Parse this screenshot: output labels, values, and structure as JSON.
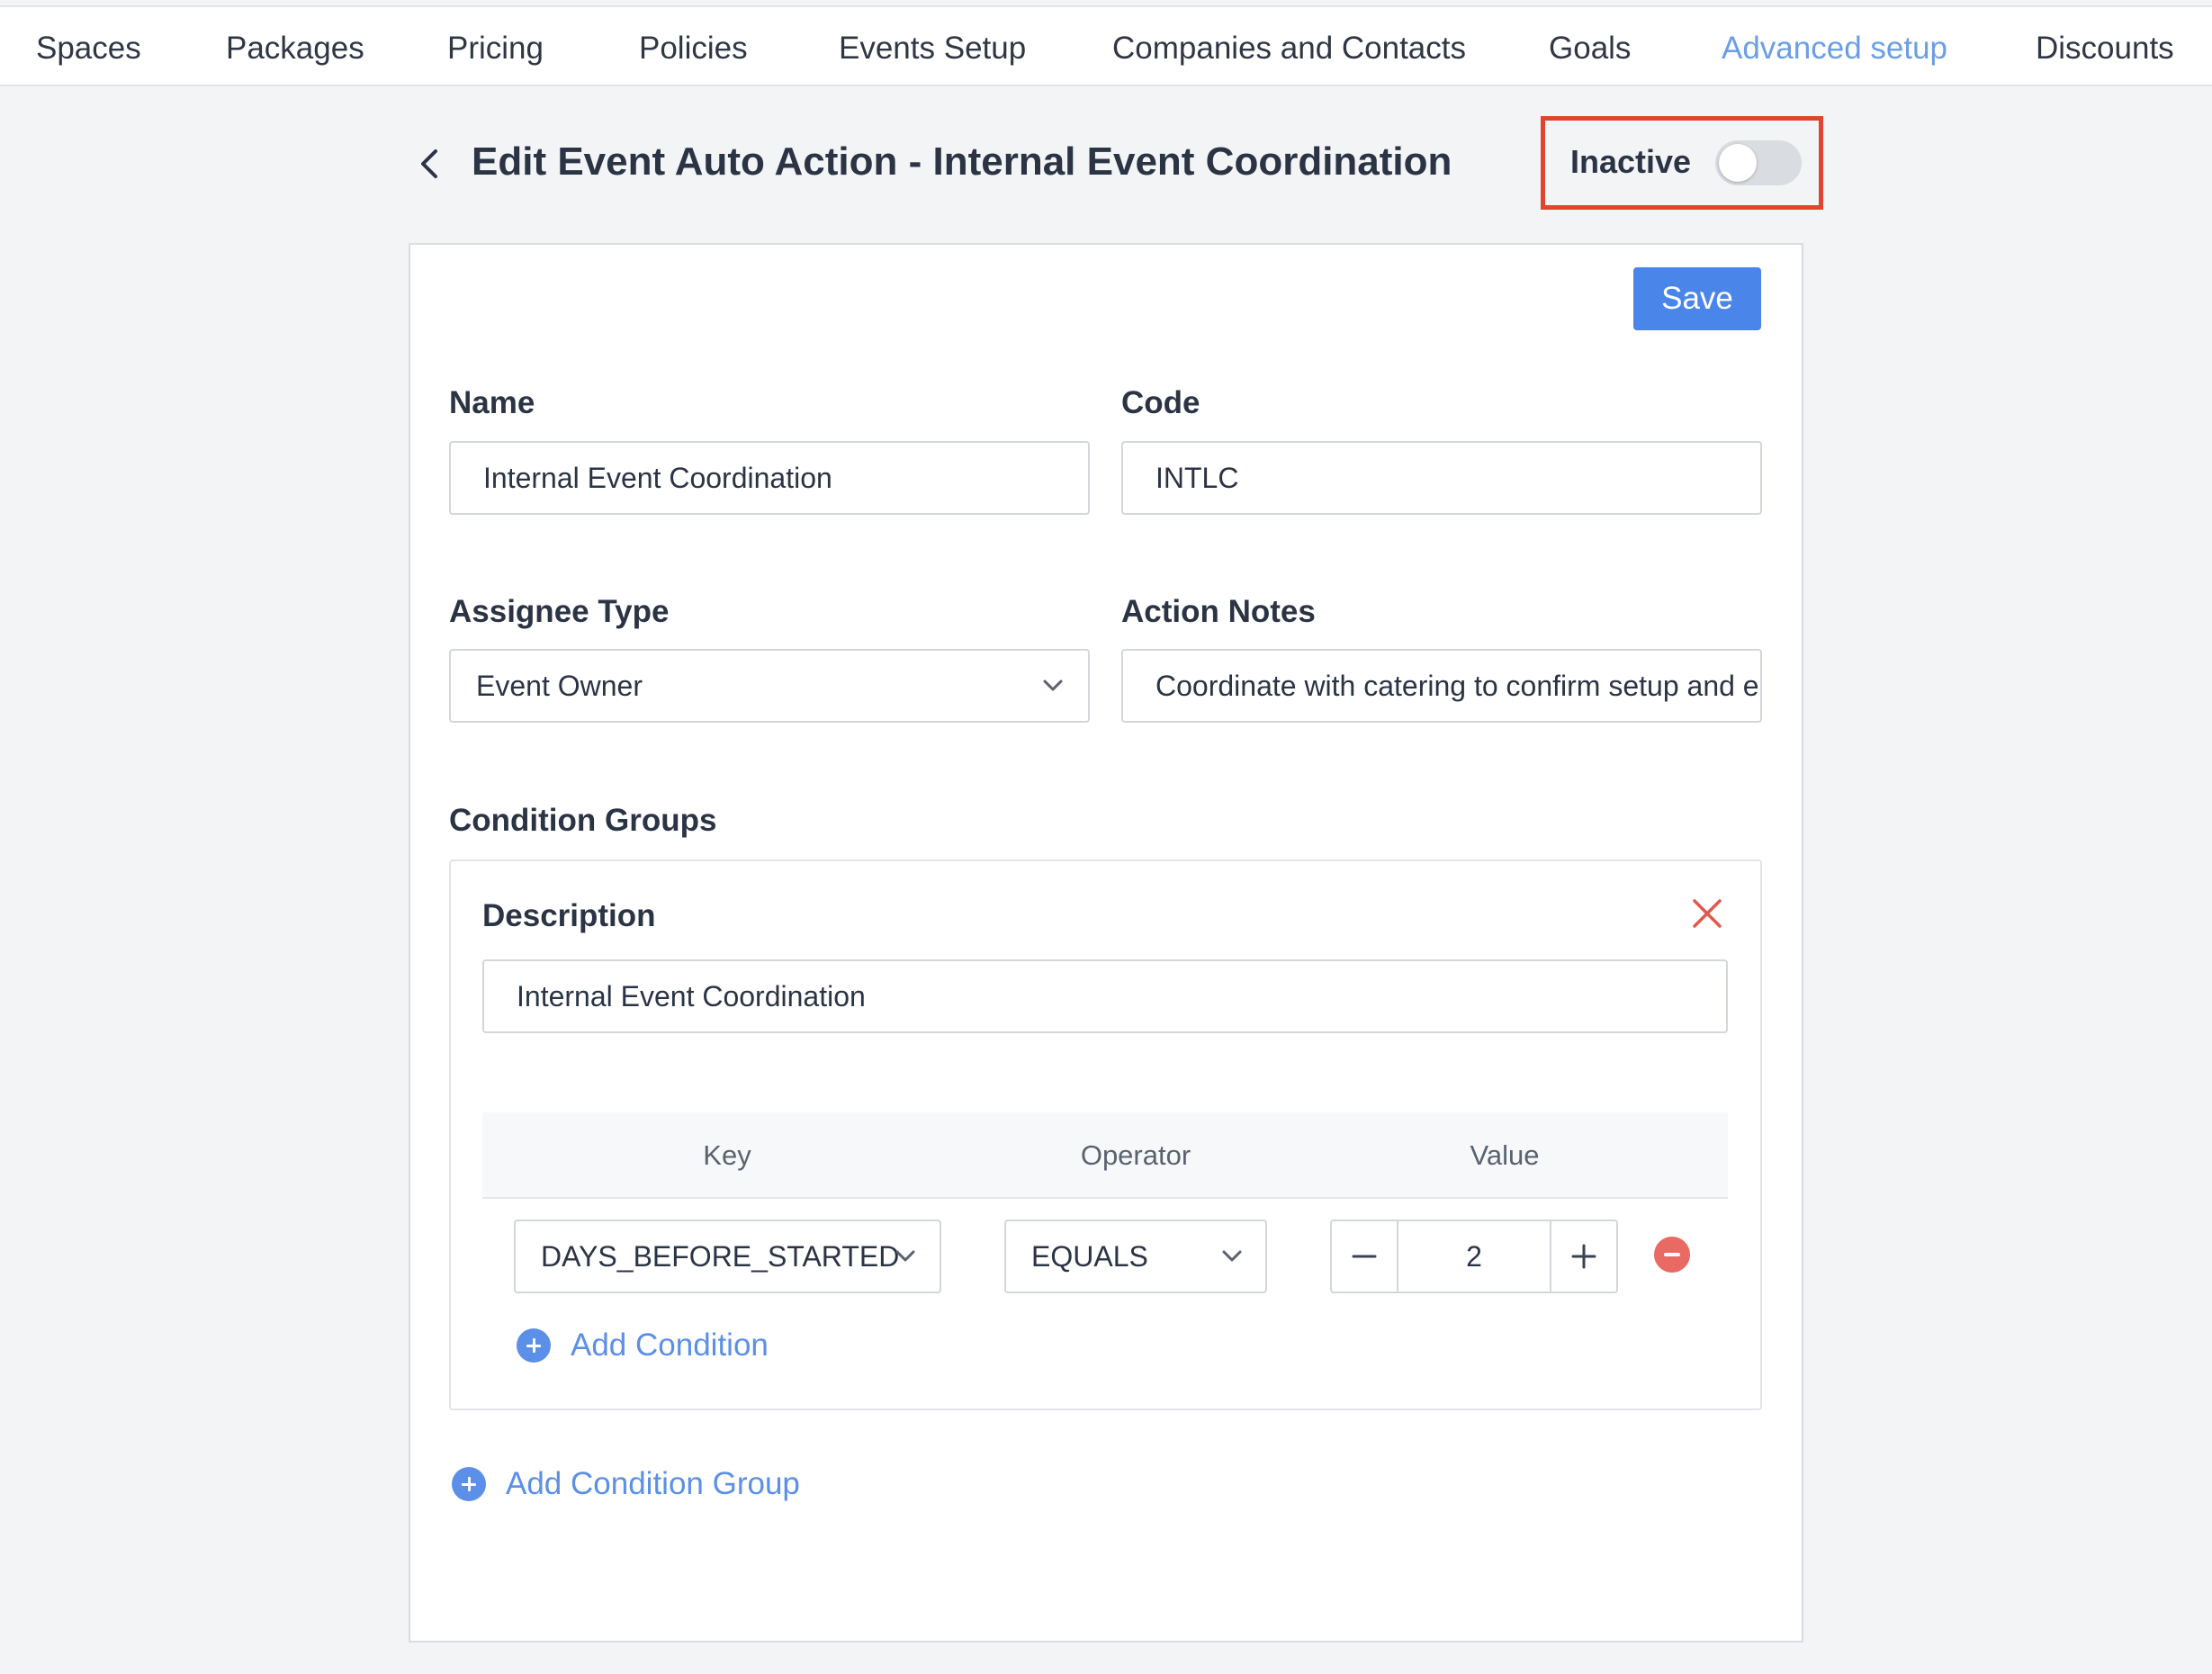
{
  "nav": {
    "items": [
      {
        "label": "Spaces"
      },
      {
        "label": "Packages"
      },
      {
        "label": "Pricing"
      },
      {
        "label": "Policies"
      },
      {
        "label": "Events Setup"
      },
      {
        "label": "Companies and Contacts"
      },
      {
        "label": "Goals"
      },
      {
        "label": "Advanced setup",
        "active": true
      },
      {
        "label": "Discounts"
      }
    ]
  },
  "header": {
    "title": "Edit Event Auto Action - Internal Event Coordination",
    "status_label": "Inactive",
    "active": false,
    "back_icon": "chevron-left-icon"
  },
  "form": {
    "save_label": "Save",
    "name": {
      "label": "Name",
      "value": "Internal Event Coordination"
    },
    "code": {
      "label": "Code",
      "value": "INTLC"
    },
    "assignee_type": {
      "label": "Assignee Type",
      "value": "Event Owner"
    },
    "action_notes": {
      "label": "Action Notes",
      "value": "Coordinate with catering to confirm setup and e"
    }
  },
  "condition_groups": {
    "label": "Condition Groups",
    "groups": [
      {
        "description_label": "Description",
        "description_value": "Internal Event Coordination",
        "columns": [
          "Key",
          "Operator",
          "Value"
        ],
        "conditions": [
          {
            "key": "DAYS_BEFORE_STARTED",
            "operator": "EQUALS",
            "value": "2"
          }
        ],
        "add_condition_label": "Add Condition"
      }
    ],
    "add_group_label": "Add Condition Group"
  },
  "colors": {
    "accent": "#4a86ea",
    "link": "#5b8fe8",
    "nav_active": "#6b9ee6",
    "highlight": "#e2452d",
    "danger": "#e86a62"
  }
}
